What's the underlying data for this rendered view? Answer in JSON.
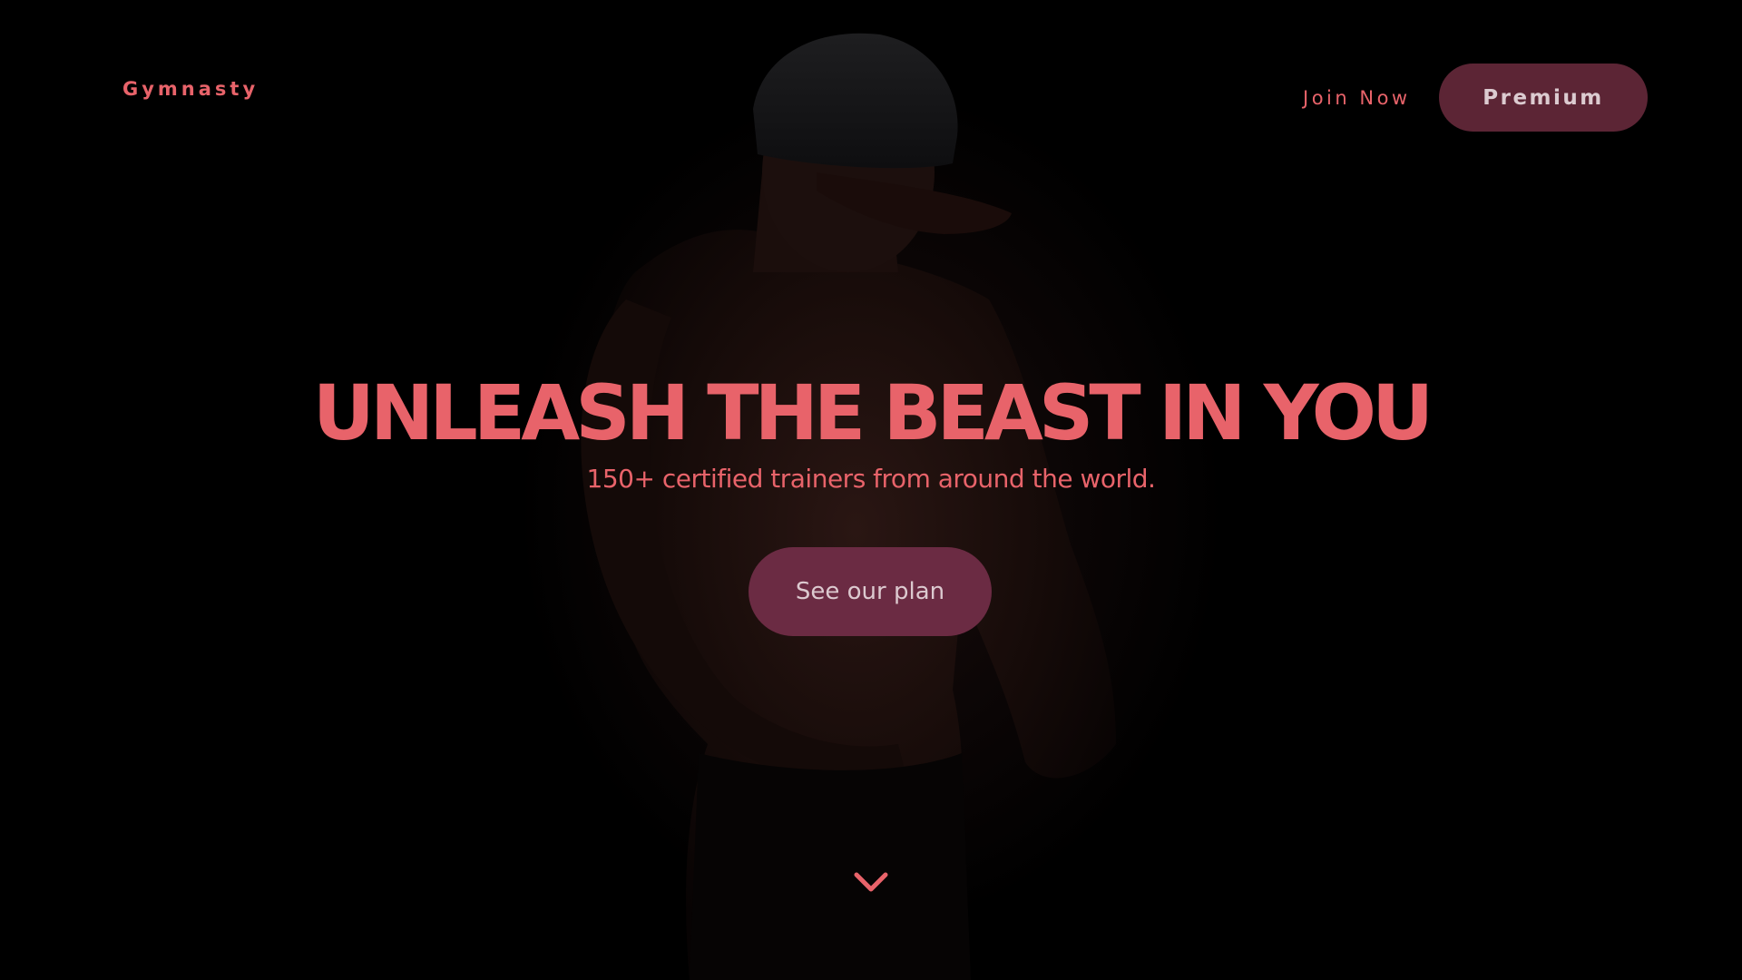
{
  "brand": {
    "logo_text": "Gymnasty"
  },
  "nav": {
    "join_label": "Join Now",
    "premium_label": "Premium"
  },
  "hero": {
    "headline": "UNLEASH THE BEAST IN YOU",
    "subtitle": "150+ certified trainers from around the world.",
    "cta_label": "See our plan",
    "background_image": "dimmed-photo-of-athlete-in-cap",
    "scroll_icon": "chevron-down-icon"
  },
  "colors": {
    "background": "#000000",
    "accent": "#e8636a",
    "premium_button_bg": "#5c2535",
    "premium_button_text": "#dccbd0",
    "cta_button_bg": "#6b2b43",
    "cta_button_text": "#dcc9cf"
  }
}
